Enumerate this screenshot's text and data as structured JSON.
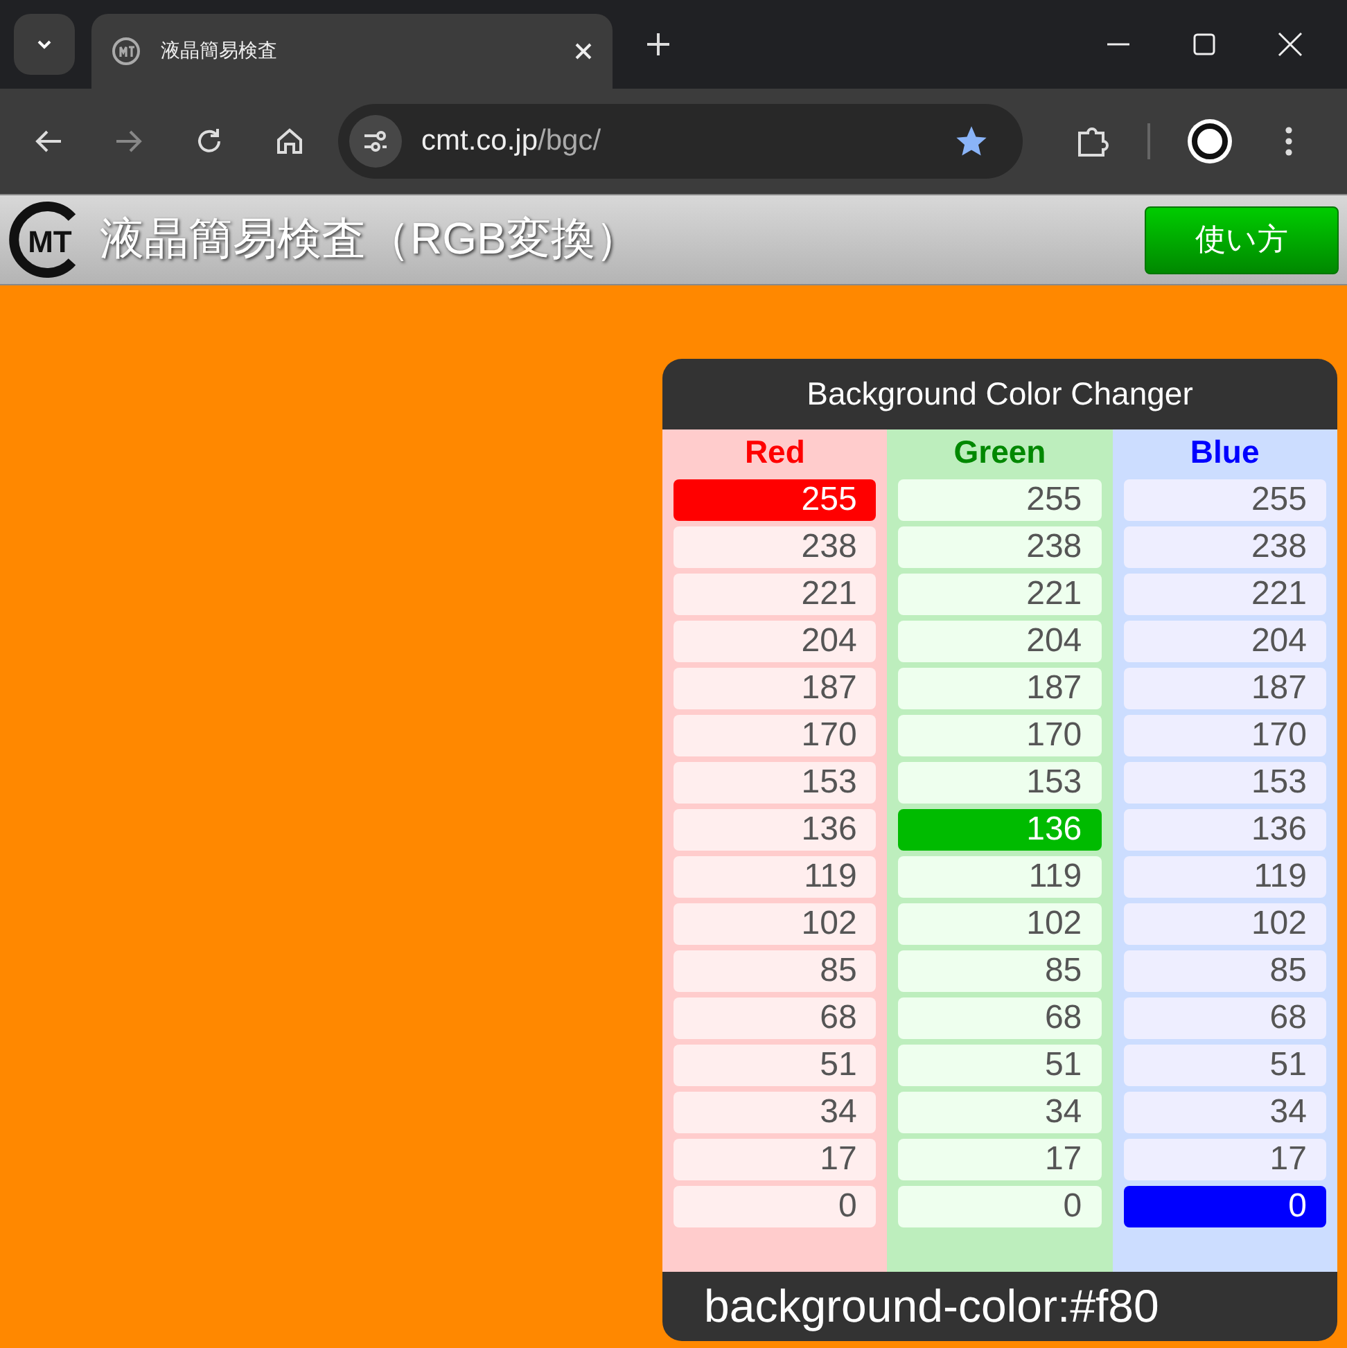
{
  "browser": {
    "tab": {
      "title": "液晶簡易検査",
      "selected": true
    },
    "address": {
      "host": "cmt.co.jp",
      "path": "/bgc/"
    },
    "bookmarked": true
  },
  "header": {
    "logo_text": "MT",
    "title": "液晶簡易検査（RGB変換）",
    "help_button": "使い方"
  },
  "panel": {
    "title": "Background Color Changer",
    "columns": [
      {
        "kind": "red",
        "label": "Red",
        "values": [
          {
            "v": "255",
            "selected": true
          },
          {
            "v": "238",
            "selected": false
          },
          {
            "v": "221",
            "selected": false
          },
          {
            "v": "204",
            "selected": false
          },
          {
            "v": "187",
            "selected": false
          },
          {
            "v": "170",
            "selected": false
          },
          {
            "v": "153",
            "selected": false
          },
          {
            "v": "136",
            "selected": false
          },
          {
            "v": "119",
            "selected": false
          },
          {
            "v": "102",
            "selected": false
          },
          {
            "v": "85",
            "selected": false
          },
          {
            "v": "68",
            "selected": false
          },
          {
            "v": "51",
            "selected": false
          },
          {
            "v": "34",
            "selected": false
          },
          {
            "v": "17",
            "selected": false
          },
          {
            "v": "0",
            "selected": false
          }
        ]
      },
      {
        "kind": "green",
        "label": "Green",
        "values": [
          {
            "v": "255",
            "selected": false
          },
          {
            "v": "238",
            "selected": false
          },
          {
            "v": "221",
            "selected": false
          },
          {
            "v": "204",
            "selected": false
          },
          {
            "v": "187",
            "selected": false
          },
          {
            "v": "170",
            "selected": false
          },
          {
            "v": "153",
            "selected": false
          },
          {
            "v": "136",
            "selected": true
          },
          {
            "v": "119",
            "selected": false
          },
          {
            "v": "102",
            "selected": false
          },
          {
            "v": "85",
            "selected": false
          },
          {
            "v": "68",
            "selected": false
          },
          {
            "v": "51",
            "selected": false
          },
          {
            "v": "34",
            "selected": false
          },
          {
            "v": "17",
            "selected": false
          },
          {
            "v": "0",
            "selected": false
          }
        ]
      },
      {
        "kind": "blue",
        "label": "Blue",
        "values": [
          {
            "v": "255",
            "selected": false
          },
          {
            "v": "238",
            "selected": false
          },
          {
            "v": "221",
            "selected": false
          },
          {
            "v": "204",
            "selected": false
          },
          {
            "v": "187",
            "selected": false
          },
          {
            "v": "170",
            "selected": false
          },
          {
            "v": "153",
            "selected": false
          },
          {
            "v": "136",
            "selected": false
          },
          {
            "v": "119",
            "selected": false
          },
          {
            "v": "102",
            "selected": false
          },
          {
            "v": "85",
            "selected": false
          },
          {
            "v": "68",
            "selected": false
          },
          {
            "v": "51",
            "selected": false
          },
          {
            "v": "34",
            "selected": false
          },
          {
            "v": "17",
            "selected": false
          },
          {
            "v": "0",
            "selected": true
          }
        ]
      }
    ],
    "css_output": "background-color:#f80"
  }
}
